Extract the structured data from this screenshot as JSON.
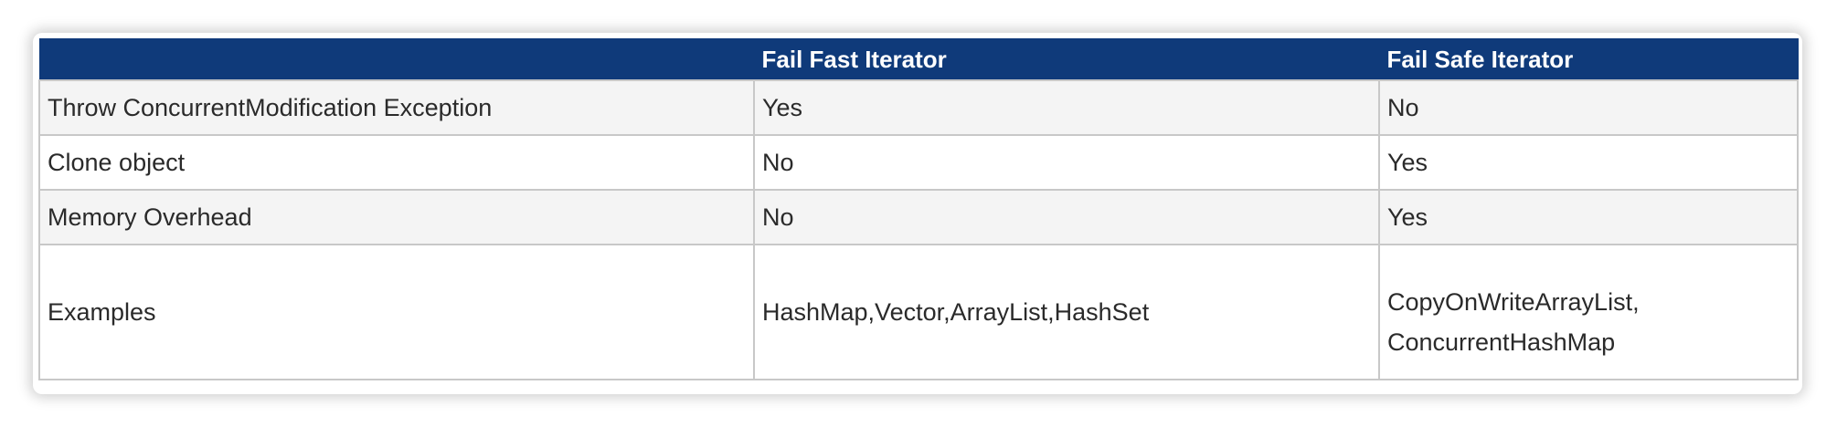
{
  "table": {
    "headers": [
      "",
      "Fail Fast Iterator",
      "Fail Safe Iterator"
    ],
    "rows": [
      [
        "Throw ConcurrentModification Exception",
        "Yes",
        "No"
      ],
      [
        "Clone object",
        "No",
        "Yes"
      ],
      [
        "Memory Overhead",
        "No",
        "Yes"
      ],
      [
        "Examples",
        "HashMap,Vector,ArrayList,HashSet",
        [
          "CopyOnWriteArrayList,",
          "ConcurrentHashMap"
        ]
      ]
    ]
  },
  "colors": {
    "header_bg": "#0f3a7a",
    "header_text": "#ffffff",
    "row_alt_bg": "#f4f4f4",
    "border": "#c8c8c8"
  }
}
